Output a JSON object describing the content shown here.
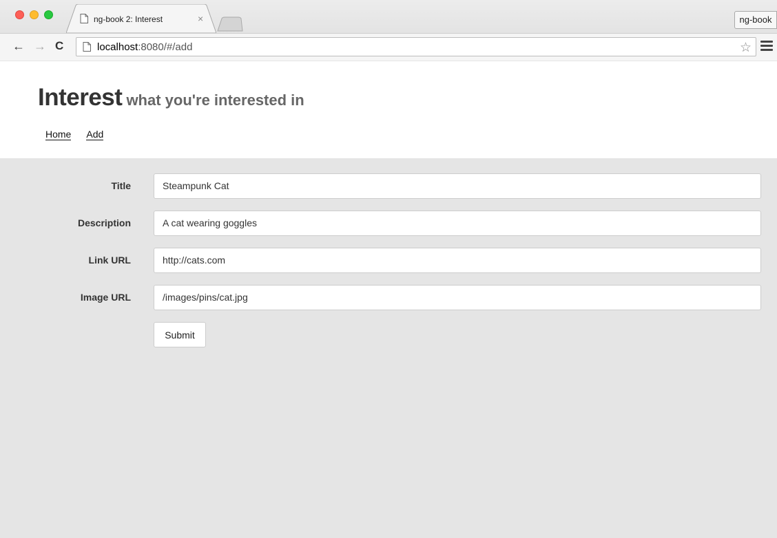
{
  "browser": {
    "tab": {
      "title": "ng-book 2: Interest",
      "close": "×"
    },
    "profile": "ng-book",
    "address": {
      "host": "localhost",
      "path": ":8080/#/add"
    },
    "icons": {
      "back": "←",
      "forward": "→",
      "reload": "C",
      "star": "☆"
    }
  },
  "header": {
    "brand": "Interest",
    "tagline": "what you're interested in",
    "nav": [
      {
        "label": "Home"
      },
      {
        "label": "Add"
      }
    ]
  },
  "form": {
    "fields": [
      {
        "label": "Title",
        "value": "Steampunk Cat"
      },
      {
        "label": "Description",
        "value": "A cat wearing goggles"
      },
      {
        "label": "Link URL",
        "value": "http://cats.com"
      },
      {
        "label": "Image URL",
        "value": "/images/pins/cat.jpg"
      }
    ],
    "submit_label": "Submit"
  }
}
